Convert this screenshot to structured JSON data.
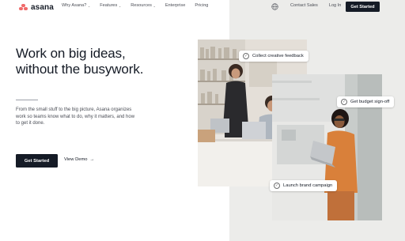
{
  "nav": {
    "brand": "asana",
    "links": [
      {
        "label": "Why Asana?",
        "has_menu": true
      },
      {
        "label": "Features",
        "has_menu": true
      },
      {
        "label": "Resources",
        "has_menu": true
      },
      {
        "label": "Enterprise",
        "has_menu": false
      },
      {
        "label": "Pricing",
        "has_menu": false
      }
    ],
    "contact_sales": "Contact Sales",
    "log_in": "Log In",
    "get_started": "Get Started",
    "chevron": "⌄"
  },
  "hero": {
    "headline_line1": "Work on big ideas,",
    "headline_line2": "without the busywork.",
    "subtext": "From the small stuff to the big picture, Asana organizes work so teams know what to do, why it matters, and how to get it done.",
    "cta_primary": "Get Started",
    "cta_secondary": "View Demo",
    "cta_secondary_arrow": "→"
  },
  "tags": {
    "tag1": "Collect creative feedback",
    "tag2": "Get budget sign-off",
    "tag3": "Launch brand campaign",
    "check_glyph": "✓"
  },
  "colors": {
    "brand_coral": "#f06a6a",
    "dark": "#151b26",
    "right_panel": "#ececea"
  },
  "icons": [
    "asana-logo-icon",
    "globe-icon",
    "chevron-down-icon",
    "arrow-right-icon",
    "check-circle-icon"
  ]
}
